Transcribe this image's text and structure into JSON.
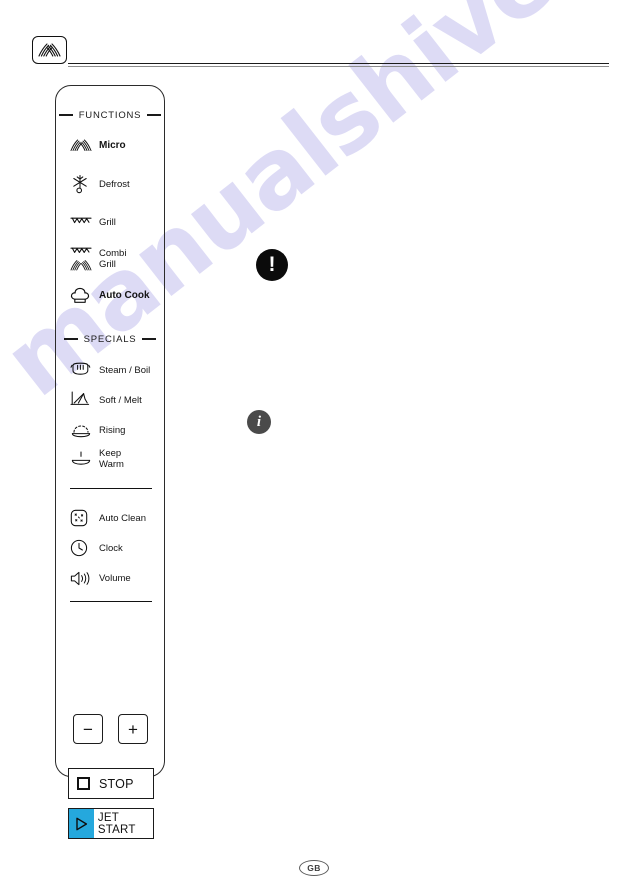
{
  "document": {
    "watermark": "manualshive.com",
    "locale_badge": "GB"
  },
  "header": {
    "brand_icon": "microwave-waves-icon"
  },
  "panel": {
    "sections": [
      {
        "id": "functions",
        "title": "FUNCTIONS",
        "items": [
          {
            "label": "Micro",
            "icon": "micro-waves-icon",
            "bold": true
          },
          {
            "label": "Defrost",
            "icon": "defrost-snowflake-icon",
            "bold": false
          },
          {
            "label": "Grill",
            "icon": "grill-element-icon",
            "bold": false
          },
          {
            "label": "Combi\nGrill",
            "icon": "combi-grill-icon",
            "bold": false
          },
          {
            "label": "Auto Cook",
            "icon": "chef-hat-icon",
            "bold": true
          }
        ]
      },
      {
        "id": "specials",
        "title": "SPECIALS",
        "items": [
          {
            "label": "Steam / Boil",
            "icon": "steam-pot-icon",
            "bold": false
          },
          {
            "label": "Soft / Melt",
            "icon": "soft-melt-icon",
            "bold": false
          },
          {
            "label": "Rising",
            "icon": "dough-rising-icon",
            "bold": false
          },
          {
            "label": "Keep\nWarm",
            "icon": "keep-warm-icon",
            "bold": false
          }
        ]
      },
      {
        "id": "settings",
        "title": "",
        "items": [
          {
            "label": "Auto Clean",
            "icon": "auto-clean-icon",
            "bold": false
          },
          {
            "label": "Clock",
            "icon": "clock-icon",
            "bold": false
          },
          {
            "label": "Volume",
            "icon": "volume-speaker-icon",
            "bold": false
          }
        ]
      }
    ],
    "stepper": {
      "decrease_label": "−",
      "increase_label": "+"
    },
    "buttons": {
      "stop_label": "STOP",
      "jet_start_label": "JET START",
      "jet_accent_color": "#25a8dd"
    }
  },
  "callouts": [
    {
      "id": "warning",
      "glyph": "!",
      "color": "#0b0b0b"
    },
    {
      "id": "info",
      "glyph": "i",
      "color": "#4a4a4a"
    }
  ]
}
